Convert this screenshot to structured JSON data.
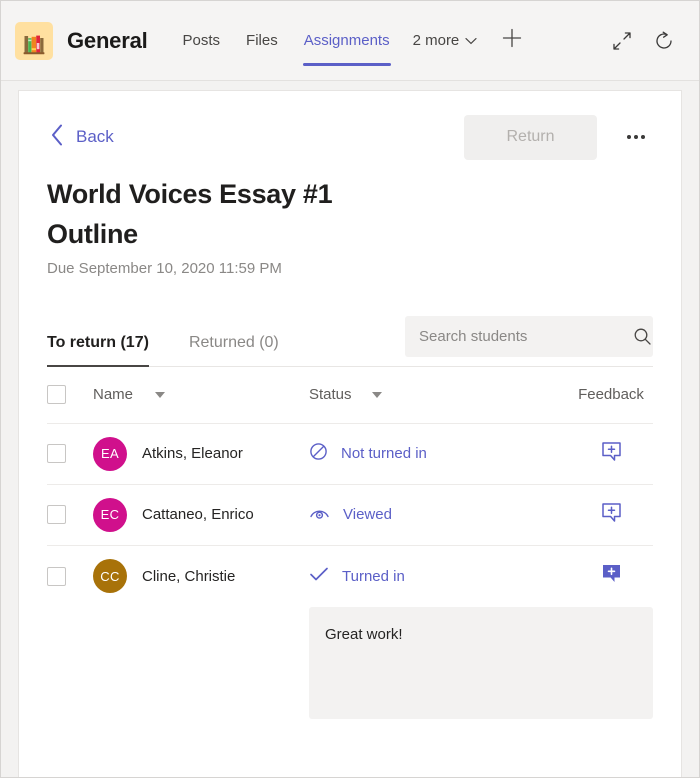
{
  "topbar": {
    "team_icon_name": "bookshelf-icon",
    "channel_title": "General",
    "tabs": [
      {
        "label": "Posts",
        "active": false
      },
      {
        "label": "Files",
        "active": false
      },
      {
        "label": "Assignments",
        "active": true
      }
    ],
    "more_label": "2 more",
    "add_tab_label": "+",
    "expand_icon": "expand-icon",
    "refresh_icon": "refresh-icon"
  },
  "toolbar": {
    "back_label": "Back",
    "return_label": "Return",
    "more_options_label": "More options"
  },
  "assignment": {
    "title": "World Voices Essay #1 Outline",
    "due_date": "Due September 10, 2020 11:59 PM"
  },
  "sub_tabs": [
    {
      "label": "To return (17)",
      "active": true
    },
    {
      "label": "Returned (0)",
      "active": false
    }
  ],
  "search": {
    "placeholder": "Search students",
    "value": "",
    "icon": "search-icon"
  },
  "table": {
    "columns": {
      "select_all": "",
      "name": "Name",
      "status": "Status",
      "feedback": "Feedback"
    },
    "rows": [
      {
        "initials": "EA",
        "avatar_color": "#D0108C",
        "name": "Atkins, Eleanor",
        "status": "Not turned in",
        "status_icon": "not-turned-in-icon",
        "feedback_icon": "add-feedback-icon",
        "feedback_filled": false,
        "feedback_open": false
      },
      {
        "initials": "EC",
        "avatar_color": "#D0108C",
        "name": "Cattaneo, Enrico",
        "status": "Viewed",
        "status_icon": "viewed-eye-icon",
        "feedback_icon": "add-feedback-icon",
        "feedback_filled": false,
        "feedback_open": false
      },
      {
        "initials": "CC",
        "avatar_color": "#A87209",
        "name": "Cline, Christie",
        "status": "Turned in",
        "status_icon": "turned-in-check-icon",
        "feedback_icon": "add-feedback-icon",
        "feedback_filled": true,
        "feedback_open": true
      }
    ]
  },
  "feedback_editor": {
    "value": "Great work!",
    "placeholder": "Feedback"
  },
  "colors": {
    "accent": "#5b5fc7",
    "page_bg": "#f3f2f1",
    "card_bg": "#ffffff",
    "disabled_text": "#b3b0ad"
  }
}
